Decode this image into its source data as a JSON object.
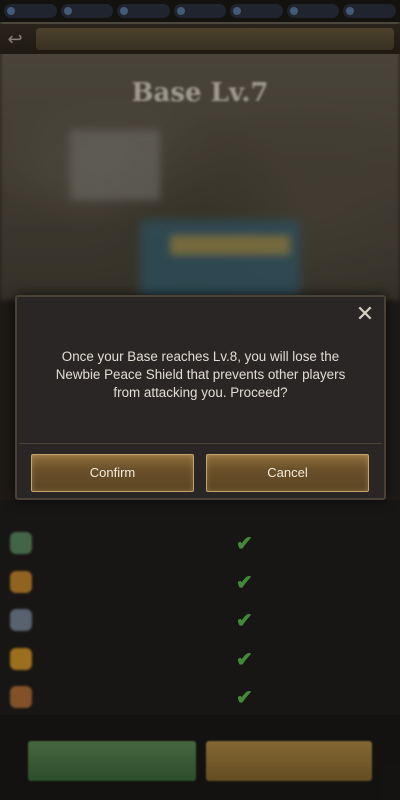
{
  "base": {
    "title": "Base Lv.7"
  },
  "dialog": {
    "message": "Once your Base reaches Lv.8, you will lose the Newbie Peace Shield that prevents other players from attacking you. Proceed?",
    "confirm_label": "Confirm",
    "cancel_label": "Cancel",
    "close_icon": "close-icon"
  },
  "colors": {
    "dialog_bg": "#292625",
    "button_gold": "#8e6e3a",
    "check_green": "#5cc04f"
  },
  "requirements": {
    "rows": [
      {
        "icon": "cash-icon",
        "check": "✔"
      },
      {
        "icon": "food-icon",
        "check": "✔"
      },
      {
        "icon": "iron-icon",
        "check": "✔"
      },
      {
        "icon": "lightning-icon",
        "check": "✔"
      },
      {
        "icon": "wood-icon",
        "check": "✔"
      }
    ]
  }
}
